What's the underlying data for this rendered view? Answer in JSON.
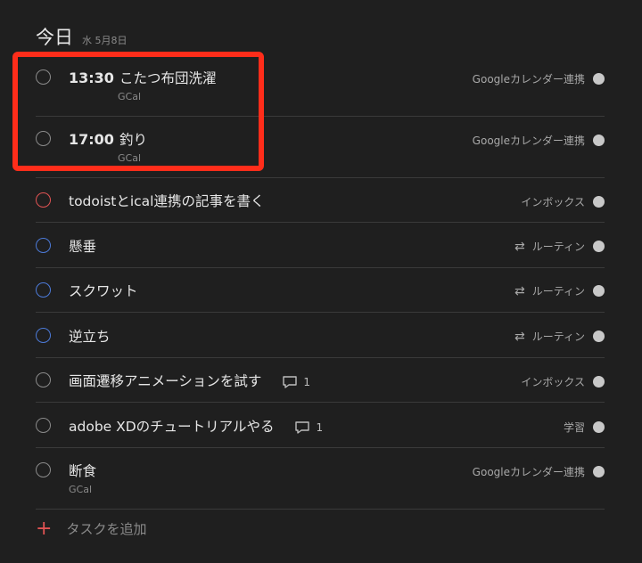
{
  "header": {
    "title": "今日",
    "date": "水 5月8日"
  },
  "tasks": [
    {
      "time": "13:30",
      "title": "こたつ布団洗濯",
      "sub": "GCal",
      "project": "Googleカレンダー連携"
    },
    {
      "time": "17:00",
      "title": "釣り",
      "sub": "GCal",
      "project": "Googleカレンダー連携"
    },
    {
      "title": "todoistとical連携の記事を書く",
      "project": "インボックス",
      "priority": "red"
    },
    {
      "title": "懸垂",
      "project": "ルーティン",
      "priority": "blue",
      "recurring": true
    },
    {
      "title": "スクワット",
      "project": "ルーティン",
      "priority": "blue",
      "recurring": true
    },
    {
      "title": "逆立ち",
      "project": "ルーティン",
      "priority": "blue",
      "recurring": true
    },
    {
      "title": "画面遷移アニメーションを試す",
      "project": "インボックス",
      "comments": "1"
    },
    {
      "title": "adobe XDのチュートリアルやる",
      "project": "学習",
      "comments": "1"
    },
    {
      "title": "断食",
      "sub": "GCal",
      "project": "Googleカレンダー連携"
    }
  ],
  "add_task": {
    "label": "タスクを追加"
  },
  "colors": {
    "background": "#1f1f1f",
    "priority_red": "#e05353",
    "priority_blue": "#4c7ad8",
    "highlight": "#ff2d1a"
  }
}
